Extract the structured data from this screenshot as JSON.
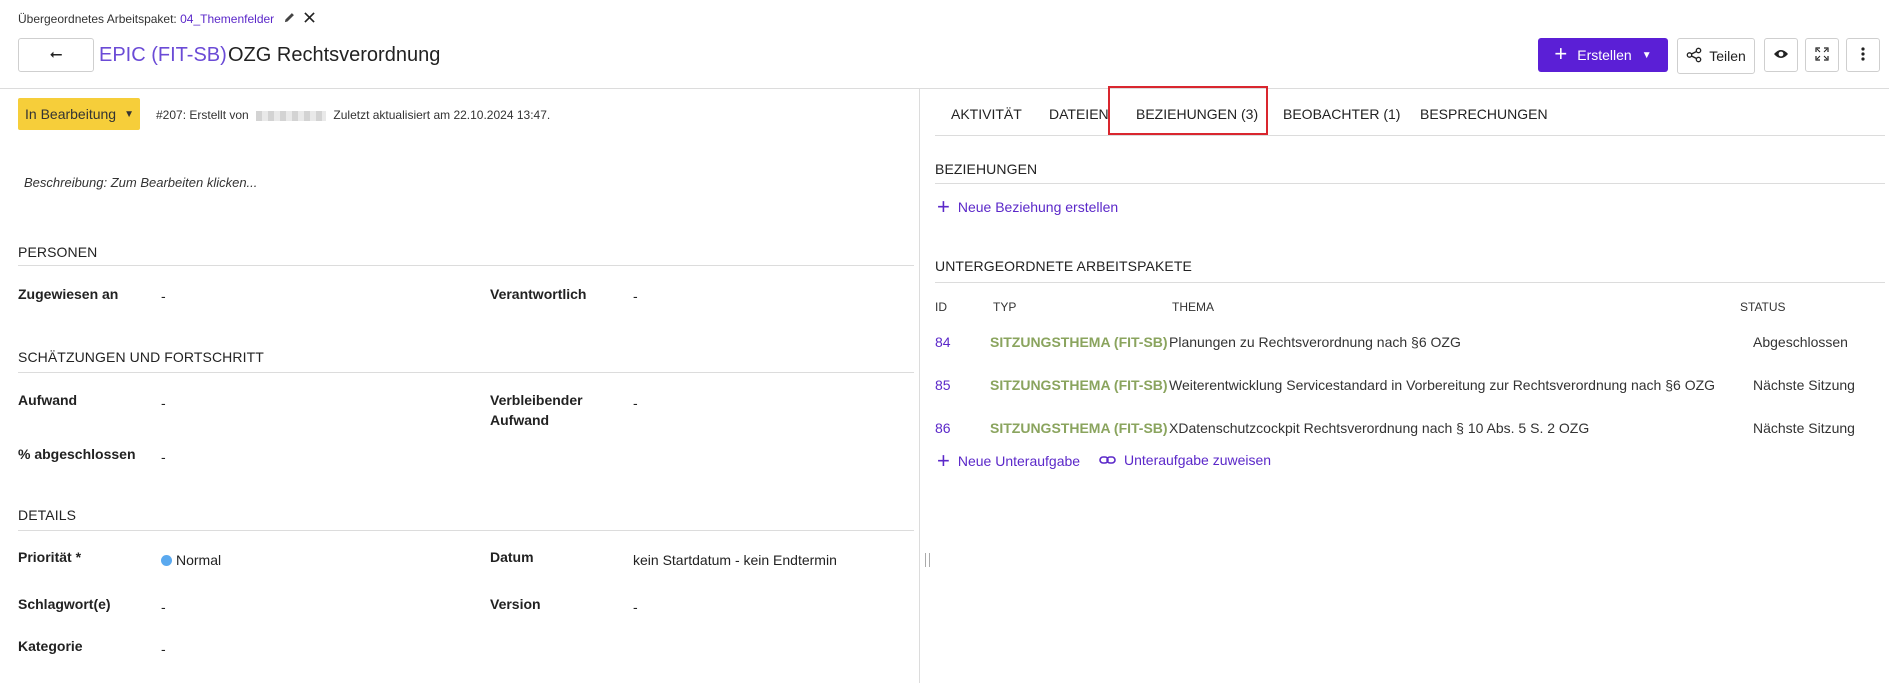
{
  "header": {
    "parent_label": "Übergeordnetes Arbeitspaket:",
    "parent_link": "04_Themenfelder",
    "edit_icon": "pencil-icon",
    "remove_icon": "close-icon",
    "back_icon": "⭠",
    "type": "EPIC (FIT-SB)",
    "subject": "OZG Rechtsverordnung",
    "create_label": "Erstellen",
    "share_label": "Teilen"
  },
  "status": {
    "label": "In Bearbeitung",
    "color": "#f6ce3a"
  },
  "meta": {
    "prefix": "#207: Erstellt von",
    "suffix": "Zuletzt aktualisiert am 22.10.2024 13:47."
  },
  "description_placeholder": "Beschreibung: Zum Bearbeiten klicken...",
  "sections": {
    "personen": {
      "title": "PERSONEN",
      "assignee_label": "Zugewiesen an",
      "assignee_value": "-",
      "responsible_label": "Verantwortlich",
      "responsible_value": "-"
    },
    "estimates": {
      "title": "SCHÄTZUNGEN UND FORTSCHRITT",
      "effort_label": "Aufwand",
      "effort_value": "-",
      "remaining_label_1": "Verbleibender",
      "remaining_label_2": "Aufwand",
      "remaining_value": "-",
      "done_label": "% abgeschlossen",
      "done_value": "-"
    },
    "details": {
      "title": "DETAILS",
      "priority_label": "Priorität *",
      "priority_value": "Normal",
      "priority_color": "#5aa9ef",
      "date_label": "Datum",
      "date_value": "kein Startdatum - kein Endtermin",
      "tags_label": "Schlagwort(e)",
      "tags_value": "-",
      "version_label": "Version",
      "version_value": "-",
      "category_label": "Kategorie",
      "category_value": "-"
    }
  },
  "tabs": [
    {
      "label": "AKTIVITÄT"
    },
    {
      "label": "DATEIEN"
    },
    {
      "label": "BEZIEHUNGEN (3)",
      "active": true
    },
    {
      "label": "BEOBACHTER (1)"
    },
    {
      "label": "BESPRECHUNGEN"
    }
  ],
  "relations": {
    "title": "BEZIEHUNGEN",
    "new_relation": "Neue Beziehung erstellen",
    "children_title": "UNTERGEORDNETE ARBEITSPAKETE",
    "columns": [
      "ID",
      "TYP",
      "THEMA",
      "STATUS"
    ],
    "rows": [
      {
        "id": "84",
        "type": "SITZUNGSTHEMA (FIT-SB)",
        "subject": "Planungen zu Rechtsverordnung nach §6 OZG",
        "status": "Abgeschlossen"
      },
      {
        "id": "85",
        "type": "SITZUNGSTHEMA (FIT-SB)",
        "subject": "Weiterentwicklung Servicestandard in Vorbereitung zur Rechtsverordnung nach §6 OZG",
        "status": "Nächste Sitzung"
      },
      {
        "id": "86",
        "type": "SITZUNGSTHEMA (FIT-SB)",
        "subject": "XDatenschutzcockpit Rechtsverordnung nach § 10 Abs. 5 S. 2 OZG",
        "status": "Nächste Sitzung"
      }
    ],
    "new_child": "Neue Unteraufgabe",
    "assign_child": "Unteraufgabe zuweisen"
  },
  "colors": {
    "accent": "#5b1fd6",
    "link": "#5b28c9",
    "type_green": "#8aa45e",
    "highlight_red": "#d9262e"
  }
}
